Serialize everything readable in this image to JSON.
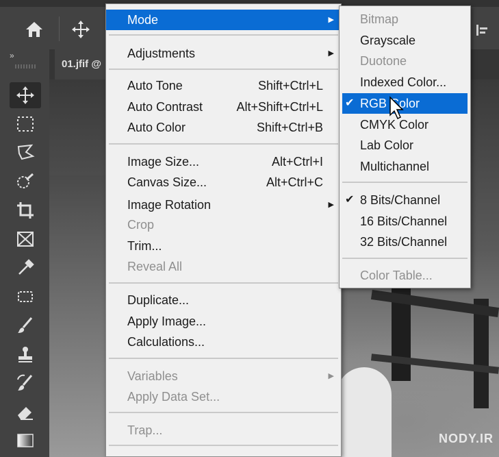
{
  "document_tab": {
    "label": "01.jfif @"
  },
  "menu": {
    "items": [
      {
        "label": "Mode",
        "shortcut": "",
        "submenu": true,
        "highlighted": true
      },
      {
        "label": "Adjustments",
        "shortcut": "",
        "submenu": true
      },
      {
        "label": "Auto Tone",
        "shortcut": "Shift+Ctrl+L"
      },
      {
        "label": "Auto Contrast",
        "shortcut": "Alt+Shift+Ctrl+L"
      },
      {
        "label": "Auto Color",
        "shortcut": "Shift+Ctrl+B"
      },
      {
        "label": "Image Size...",
        "shortcut": "Alt+Ctrl+I"
      },
      {
        "label": "Canvas Size...",
        "shortcut": "Alt+Ctrl+C"
      },
      {
        "label": "Image Rotation",
        "shortcut": "",
        "submenu": true
      },
      {
        "label": "Crop",
        "shortcut": "",
        "disabled": true
      },
      {
        "label": "Trim...",
        "shortcut": ""
      },
      {
        "label": "Reveal All",
        "shortcut": "",
        "disabled": true
      },
      {
        "label": "Duplicate...",
        "shortcut": ""
      },
      {
        "label": "Apply Image...",
        "shortcut": ""
      },
      {
        "label": "Calculations...",
        "shortcut": ""
      },
      {
        "label": "Variables",
        "shortcut": "",
        "submenu": true,
        "disabled": true
      },
      {
        "label": "Apply Data Set...",
        "shortcut": "",
        "disabled": true
      },
      {
        "label": "Trap...",
        "shortcut": "",
        "disabled": true
      }
    ]
  },
  "mode_submenu": {
    "items": [
      {
        "label": "Bitmap",
        "disabled": true
      },
      {
        "label": "Grayscale"
      },
      {
        "label": "Duotone",
        "disabled": true
      },
      {
        "label": "Indexed Color..."
      },
      {
        "label": "RGB Color",
        "checked": true,
        "highlighted": true
      },
      {
        "label": "CMYK Color"
      },
      {
        "label": "Lab Color"
      },
      {
        "label": "Multichannel"
      },
      {
        "label": "8 Bits/Channel",
        "checked": true
      },
      {
        "label": "16 Bits/Channel"
      },
      {
        "label": "32 Bits/Channel"
      },
      {
        "label": "Color Table...",
        "disabled": true
      }
    ],
    "check_glyph": "✔"
  },
  "icons": {
    "home": "home-icon",
    "move": "move-icon",
    "submenu_arrow": "▶",
    "toolbar_collapse": "»"
  },
  "watermark": {
    "text": "NODY.IR"
  },
  "colors": {
    "highlight": "#0a6cd4",
    "menu_bg": "#f0f0f0",
    "toolbar_bg": "#424242"
  }
}
